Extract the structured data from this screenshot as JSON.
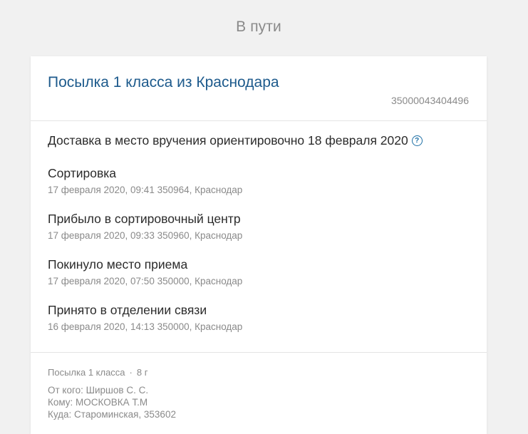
{
  "section_title": "В пути",
  "parcel": {
    "title": "Посылка 1 класса из Краснодара",
    "tracking_number": "35000043404496"
  },
  "delivery_estimate": "Доставка в место вручения ориентировочно 18 февраля 2020",
  "help_icon": "question-circle",
  "events": [
    {
      "title": "Сортировка",
      "meta": "17 февраля 2020, 09:41 350964, Краснодар"
    },
    {
      "title": "Прибыло в сортировочный центр",
      "meta": "17 февраля 2020, 09:33 350960, Краснодар"
    },
    {
      "title": "Покинуло место приема",
      "meta": "17 февраля 2020, 07:50 350000, Краснодар"
    },
    {
      "title": "Принято в отделении связи",
      "meta": "16 февраля 2020, 14:13 350000, Краснодар"
    }
  ],
  "footer": {
    "type": "Посылка 1 класса",
    "separator": "·",
    "weight": "8 г",
    "from": "От кого: Ширшов С. С.",
    "to": "Кому: МОСКОВКА Т.М",
    "address": "Куда: Староминская, 353602"
  },
  "colors": {
    "background": "#f1f1f1",
    "card": "#ffffff",
    "link": "#1d5a8c",
    "accent": "#1d6fa5",
    "text": "#2b2b2b",
    "muted": "#8a8a8a"
  }
}
